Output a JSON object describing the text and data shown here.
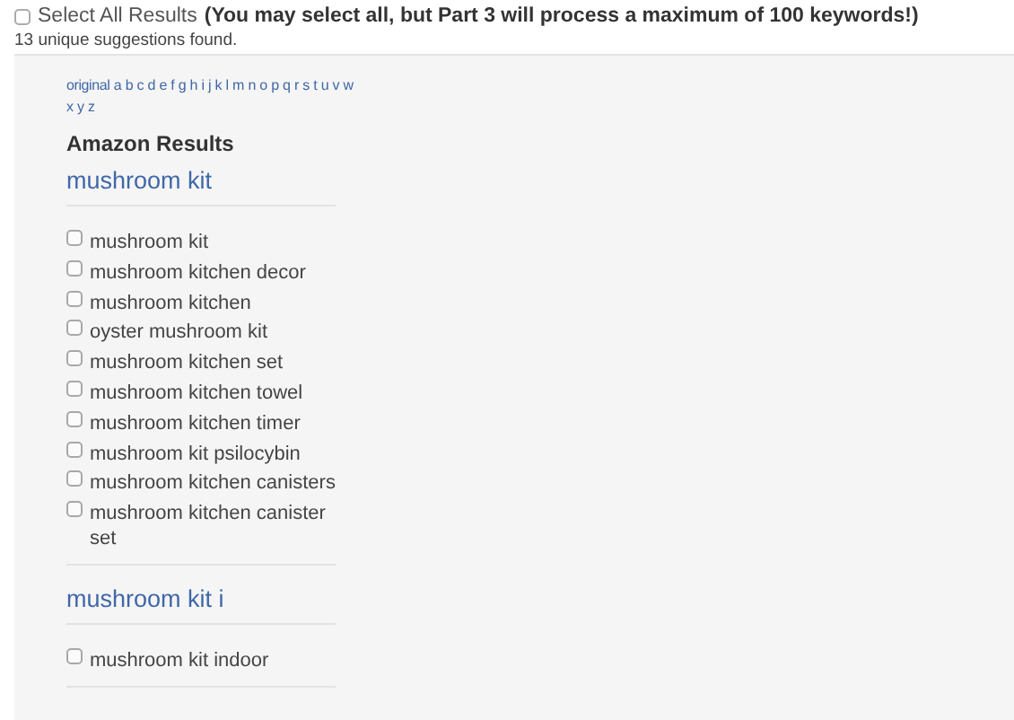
{
  "select_all": {
    "label": "Select All Results",
    "note": "(You may select all, but Part 3 will process a maximum of 100 keywords!)",
    "checked": false
  },
  "summary": "13 unique suggestions found.",
  "letter_index": [
    "original",
    "a",
    "b",
    "c",
    "d",
    "e",
    "f",
    "g",
    "h",
    "i",
    "j",
    "k",
    "l",
    "m",
    "n",
    "o",
    "p",
    "q",
    "r",
    "s",
    "t",
    "u",
    "v",
    "w",
    "x",
    "y",
    "z"
  ],
  "results_title": "Amazon Results",
  "groups": [
    {
      "heading": "mushroom kit",
      "items": [
        {
          "label": "mushroom kit",
          "checked": false
        },
        {
          "label": "mushroom kitchen decor",
          "checked": false
        },
        {
          "label": "mushroom kitchen",
          "checked": false
        },
        {
          "label": "oyster mushroom kit",
          "checked": false
        },
        {
          "label": "mushroom kitchen set",
          "checked": false
        },
        {
          "label": "mushroom kitchen towel",
          "checked": false
        },
        {
          "label": "mushroom kitchen timer",
          "checked": false
        },
        {
          "label": "mushroom kit psilocybin",
          "checked": false
        },
        {
          "label": "mushroom kitchen canisters",
          "checked": false
        },
        {
          "label": "mushroom kitchen canister set",
          "checked": false
        }
      ]
    },
    {
      "heading": "mushroom kit i",
      "items": [
        {
          "label": "mushroom kit indoor",
          "checked": false
        }
      ]
    }
  ]
}
